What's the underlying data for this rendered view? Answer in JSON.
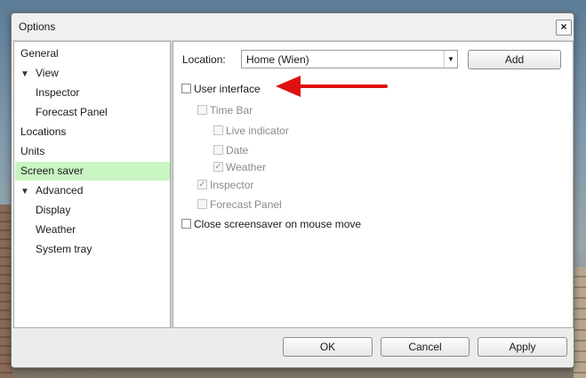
{
  "dialog": {
    "title": "Options"
  },
  "sidebar": {
    "items": [
      {
        "label": "General",
        "expander": ""
      },
      {
        "label": "View",
        "expander": "▼"
      },
      {
        "label": "Inspector",
        "expander": ""
      },
      {
        "label": "Forecast Panel",
        "expander": ""
      },
      {
        "label": "Locations",
        "expander": ""
      },
      {
        "label": "Units",
        "expander": ""
      },
      {
        "label": "Screen saver",
        "expander": "",
        "selected": true
      },
      {
        "label": "Advanced",
        "expander": "▼"
      },
      {
        "label": "Display",
        "expander": ""
      },
      {
        "label": "Weather",
        "expander": ""
      },
      {
        "label": "System tray",
        "expander": ""
      }
    ]
  },
  "screensaver": {
    "location_label": "Location:",
    "location_value": "Home (Wien)",
    "add_label": "Add",
    "options": [
      {
        "label": "User interface",
        "checked": false,
        "enabled": true
      },
      {
        "label": "Time Bar",
        "checked": false,
        "enabled": false
      },
      {
        "label": "Live indicator",
        "checked": false,
        "enabled": false
      },
      {
        "label": "Date",
        "checked": false,
        "enabled": false
      },
      {
        "label": "Weather",
        "checked": true,
        "enabled": false
      },
      {
        "label": "Inspector",
        "checked": true,
        "enabled": false
      },
      {
        "label": "Forecast Panel",
        "checked": false,
        "enabled": false
      },
      {
        "label": "Close screensaver on mouse move",
        "checked": false,
        "enabled": true
      }
    ]
  },
  "footer": {
    "ok_label": "OK",
    "cancel_label": "Cancel",
    "apply_label": "Apply"
  },
  "colors": {
    "selection": "#c9f5c2",
    "annotation_arrow": "#e01010"
  }
}
